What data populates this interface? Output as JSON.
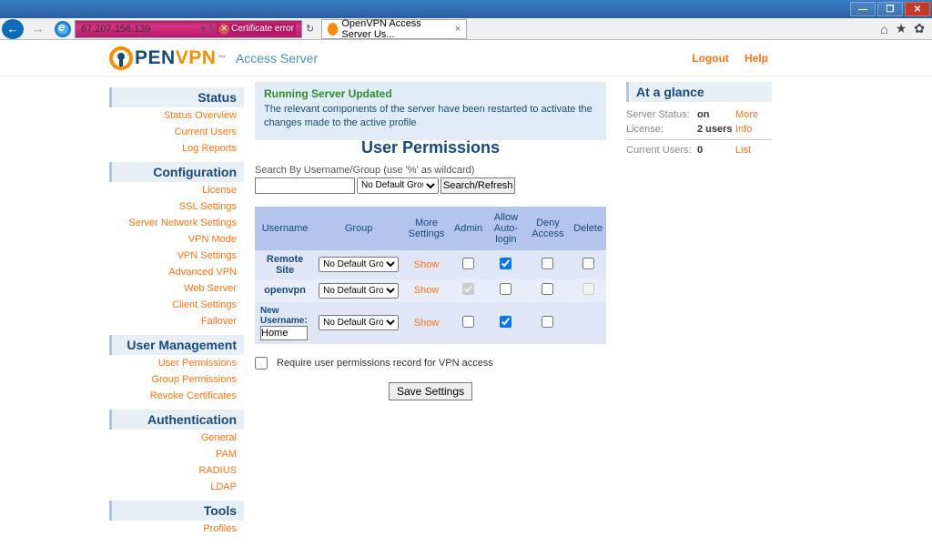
{
  "window": {
    "min": "—",
    "max": "❐",
    "close": "✕"
  },
  "browser": {
    "back": "←",
    "forward": "→",
    "address": "67.207.156.139",
    "refresh": "↻",
    "cert_error": "Certificate error",
    "tab_title": "OpenVPN Access Server Us...",
    "tab_close": "×",
    "home_icon": "⌂",
    "star_icon": "★",
    "gear_icon": "✿"
  },
  "header": {
    "logo_pen": "PEN",
    "logo_vpn": "VPN",
    "tm": "™",
    "subtitle": "Access Server",
    "logout": "Logout",
    "help": "Help"
  },
  "sidebar": {
    "sections": [
      {
        "title": "Status",
        "items": [
          "Status Overview",
          "Current Users",
          "Log Reports"
        ]
      },
      {
        "title": "Configuration",
        "items": [
          "License",
          "SSL Settings",
          "Server Network Settings",
          "VPN Mode",
          "VPN Settings",
          "Advanced VPN",
          "Web Server",
          "Client Settings",
          "Failover"
        ]
      },
      {
        "title": "User Management",
        "items": [
          "User Permissions",
          "Group Permissions",
          "Revoke Certificates"
        ]
      },
      {
        "title": "Authentication",
        "items": [
          "General",
          "PAM",
          "RADIUS",
          "LDAP"
        ]
      },
      {
        "title": "Tools",
        "items": [
          "Profiles"
        ]
      }
    ]
  },
  "alert": {
    "title": "Running Server Updated",
    "body": "The relevant components of the server have been restarted to activate the changes made to the active profile"
  },
  "page_title": "User Permissions",
  "search": {
    "label": "Search By Username/Group (use '%' as wildcard)",
    "input_value": "",
    "group_option": "No Default Group",
    "button": "Search/Refresh"
  },
  "table": {
    "headers": [
      "Username",
      "Group",
      "More Settings",
      "Admin",
      "Allow Auto-login",
      "Deny Access",
      "Delete"
    ],
    "group_option": "No Default Group",
    "show": "Show",
    "rows": [
      {
        "username": "Remote Site",
        "admin": false,
        "auto": true,
        "deny": false,
        "delete": false
      },
      {
        "username": "openvpn",
        "admin": true,
        "admin_disabled": true,
        "auto": false,
        "deny": false,
        "delete_disabled": true
      }
    ],
    "new_label": "New Username:",
    "new_value": "Home",
    "new_auto": true
  },
  "require": {
    "label": "Require user permissions record for VPN access",
    "checked": false
  },
  "save_button": "Save Settings",
  "glance": {
    "title": "At a glance",
    "rows": [
      {
        "label": "Server Status:",
        "value": "on",
        "link": "More"
      },
      {
        "label": "License:",
        "value": "2 users",
        "link": "Info"
      }
    ],
    "row2": {
      "label": "Current Users:",
      "value": "0",
      "link": "List"
    }
  }
}
